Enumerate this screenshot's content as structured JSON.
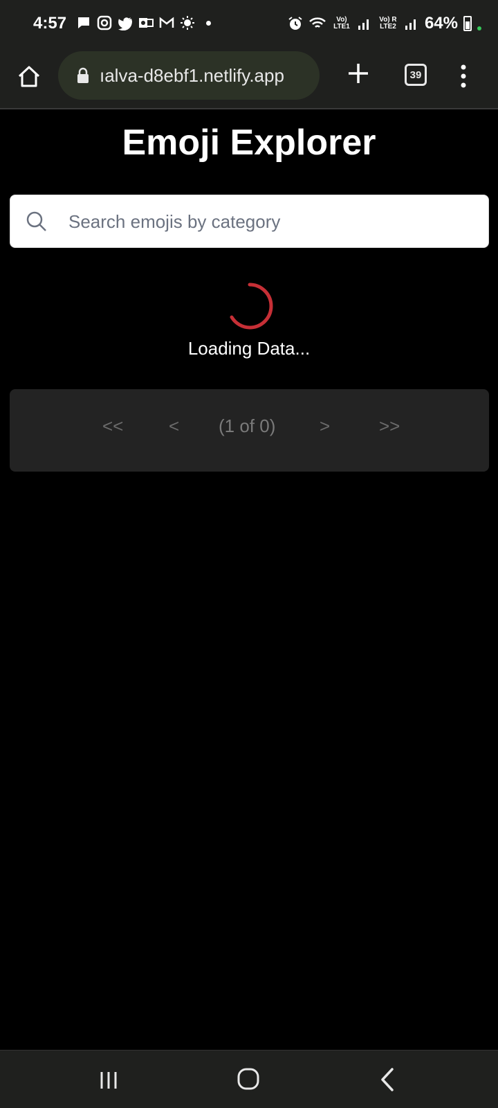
{
  "status_bar": {
    "time": "4:57",
    "left_icons": [
      "message-icon",
      "instagram-icon",
      "twitter-icon",
      "outlook-icon",
      "gmail-icon",
      "brightness-icon"
    ],
    "lte1": "Vo) LTE1",
    "lte2": "Vo) R LTE2",
    "battery": "64%"
  },
  "browser": {
    "url": "ıalva-d8ebf1.netlify.app",
    "tab_count": "39"
  },
  "page": {
    "title": "Emoji Explorer",
    "search_placeholder": "Search emojis by category",
    "loading_text": "Loading Data...",
    "spinner_color": "#c62f36"
  },
  "paginator": {
    "first": "<<",
    "prev": "<",
    "report": "(1 of 0)",
    "next": ">",
    "last": ">>"
  }
}
